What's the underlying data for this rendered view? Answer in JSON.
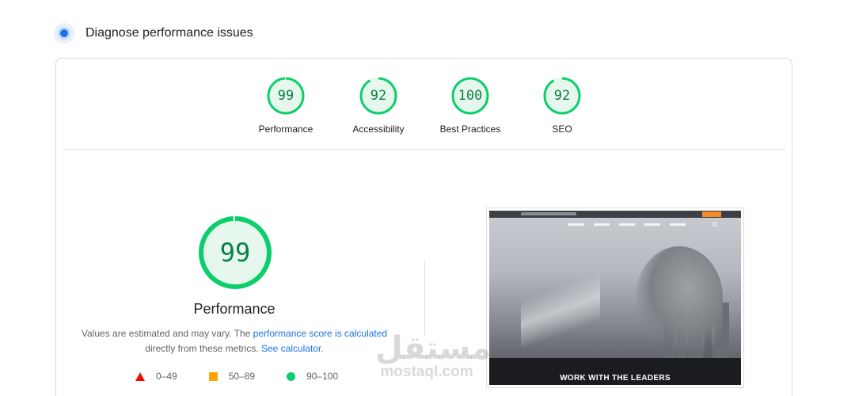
{
  "header": {
    "title": "Diagnose performance issues",
    "icon": "lighthouse-icon"
  },
  "categories": [
    {
      "label": "Performance",
      "score": "99",
      "fraction": 0.99
    },
    {
      "label": "Accessibility",
      "score": "92",
      "fraction": 0.92
    },
    {
      "label": "Best Practices",
      "score": "100",
      "fraction": 1.0
    },
    {
      "label": "SEO",
      "score": "92",
      "fraction": 0.92
    }
  ],
  "main": {
    "score": "99",
    "fraction": 0.99,
    "title": "Performance",
    "desc_part1": "Values are estimated and may vary. The ",
    "desc_link1": "performance score is calculated",
    "desc_part2": "directly from these metrics. ",
    "desc_link2": "See calculator",
    "desc_end": "."
  },
  "legend": [
    {
      "shape": "triangle",
      "range": "0–49",
      "color": "#eb0f00"
    },
    {
      "shape": "square",
      "range": "50–89",
      "color": "#ffa400"
    },
    {
      "shape": "circle",
      "range": "90–100",
      "color": "#0cce6b"
    }
  ],
  "screenshot": {
    "headline": "WORK WITH THE LEADERS"
  },
  "watermark": {
    "arabic": "مستقل",
    "latin": "mostaql.com"
  },
  "colors": {
    "pass": "#0cce6b",
    "pass_text": "#0b8043",
    "pass_bg": "#e6f8ee",
    "link": "#1a73e8"
  }
}
